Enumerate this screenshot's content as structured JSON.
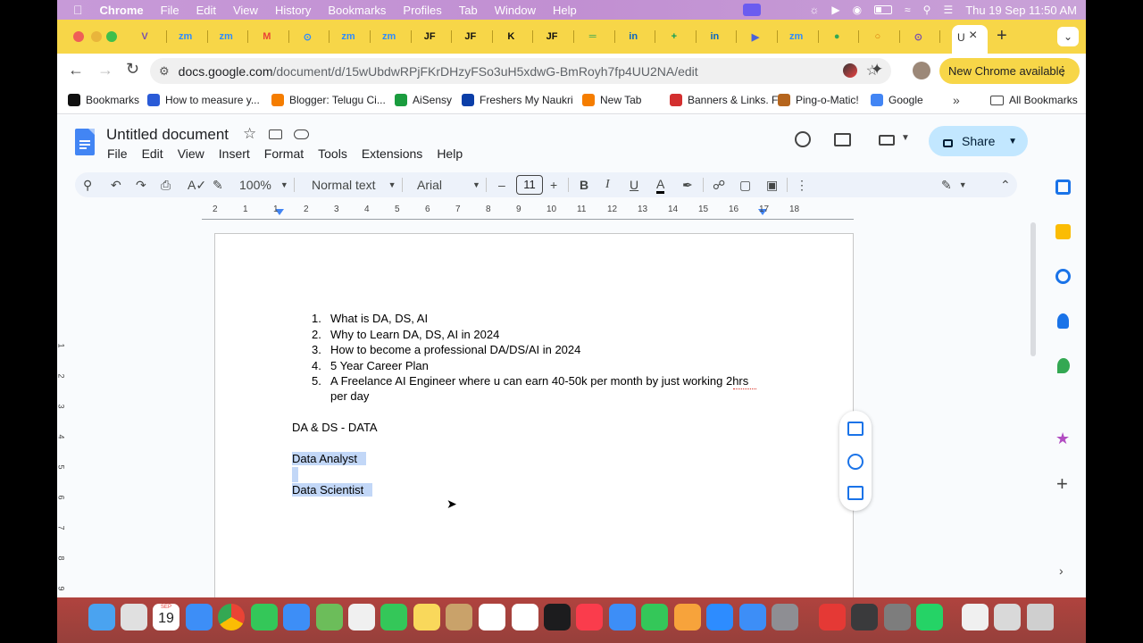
{
  "mac_menubar": {
    "app": "Chrome",
    "items": [
      "File",
      "Edit",
      "View",
      "History",
      "Bookmarks",
      "Profiles",
      "Tab",
      "Window",
      "Help"
    ],
    "clock": "Thu 19 Sep  11:50 AM"
  },
  "chrome": {
    "tabs": [
      {
        "label": "V",
        "color": "#7b52ab"
      },
      {
        "label": "zm",
        "color": "#2d8cff"
      },
      {
        "label": "zm",
        "color": "#2d8cff"
      },
      {
        "label": "M",
        "color": "#ea4335"
      },
      {
        "label": "⊙",
        "color": "#2d8cff"
      },
      {
        "label": "zm",
        "color": "#2d8cff"
      },
      {
        "label": "zm",
        "color": "#2d8cff"
      },
      {
        "label": "JF",
        "color": "#111111"
      },
      {
        "label": "JF",
        "color": "#111111"
      },
      {
        "label": "K",
        "color": "#111111"
      },
      {
        "label": "JF",
        "color": "#111111"
      },
      {
        "label": "═",
        "color": "#34a853"
      },
      {
        "label": "in",
        "color": "#0a66c2"
      },
      {
        "label": "+",
        "color": "#0f9d58"
      },
      {
        "label": "in",
        "color": "#0a66c2"
      },
      {
        "label": "▶",
        "color": "#4a62d8"
      },
      {
        "label": "zm",
        "color": "#2d8cff"
      },
      {
        "label": "●",
        "color": "#34a853"
      },
      {
        "label": "○",
        "color": "#d97706"
      },
      {
        "label": "⊙",
        "color": "#7b52ab"
      }
    ],
    "active_tab_label": "U",
    "url_host": "docs.google.com",
    "url_path": "/document/d/15wUbdwRPjFKrDHzyFSo3uH5xdwG-BmRoyh7fp4UU2NA/edit",
    "update_button": "New Chrome available",
    "bookmarks": [
      {
        "label": "Bookmarks",
        "color": "#111111"
      },
      {
        "label": "How to measure y...",
        "color": "#2a5bd7"
      },
      {
        "label": "Blogger: Telugu Ci...",
        "color": "#f57d00"
      },
      {
        "label": "AiSensy",
        "color": "#1a9c3e"
      },
      {
        "label": "Freshers My Naukri",
        "color": "#0b3ea8"
      },
      {
        "label": "New Tab",
        "color": "#f57d00"
      },
      {
        "label": "Banners & Links. F...",
        "color": "#d32f2f"
      },
      {
        "label": "Ping-o-Matic!",
        "color": "#b5651d"
      },
      {
        "label": "Google",
        "color": "#4285f4"
      }
    ],
    "all_bookmarks": "All Bookmarks"
  },
  "docs": {
    "title": "Untitled document",
    "menu": [
      "File",
      "Edit",
      "View",
      "Insert",
      "Format",
      "Tools",
      "Extensions",
      "Help"
    ],
    "share": "Share",
    "zoom": "100%",
    "style": "Normal text",
    "font": "Arial",
    "font_size": "11",
    "ruler_ticks": [
      "2",
      "1",
      "1",
      "2",
      "3",
      "4",
      "5",
      "6",
      "7",
      "8",
      "9",
      "10",
      "11",
      "12",
      "13",
      "14",
      "15",
      "16",
      "17",
      "18"
    ],
    "left_ruler_ticks": [
      "1",
      "2",
      "3",
      "4",
      "5",
      "6",
      "7",
      "8",
      "9"
    ],
    "list": [
      {
        "num": "1.",
        "text": "What is DA, DS, AI"
      },
      {
        "num": "2.",
        "text": "Why to Learn DA, DS, AI in 2024"
      },
      {
        "num": "3.",
        "text": "How to become a professional DA/DS/AI in 2024"
      },
      {
        "num": "4.",
        "text": "5 Year Career Plan"
      },
      {
        "num": "5.",
        "text": "A Freelance AI Engineer where u can earn 40-50k per month by just working 2hrs"
      }
    ],
    "list_cont": "per day",
    "heading": "DA & DS - DATA",
    "selected_1": "Data Analyst",
    "selected_2": "Data Scientist"
  },
  "dock": {
    "calendar_day": "19",
    "calendar_month": "SEP",
    "apps": [
      "finder",
      "launchpad",
      "calendar",
      "safari",
      "chrome",
      "messages",
      "mail",
      "maps",
      "photos",
      "facetime",
      "notes",
      "contacts",
      "reminders",
      "freeform",
      "tv",
      "music",
      "keynote",
      "numbers",
      "pages",
      "zoom",
      "app-store",
      "system-settings",
      "anydesk",
      "quicktime",
      "dictionary",
      "whatsapp",
      "document",
      "preview",
      "trash"
    ]
  }
}
